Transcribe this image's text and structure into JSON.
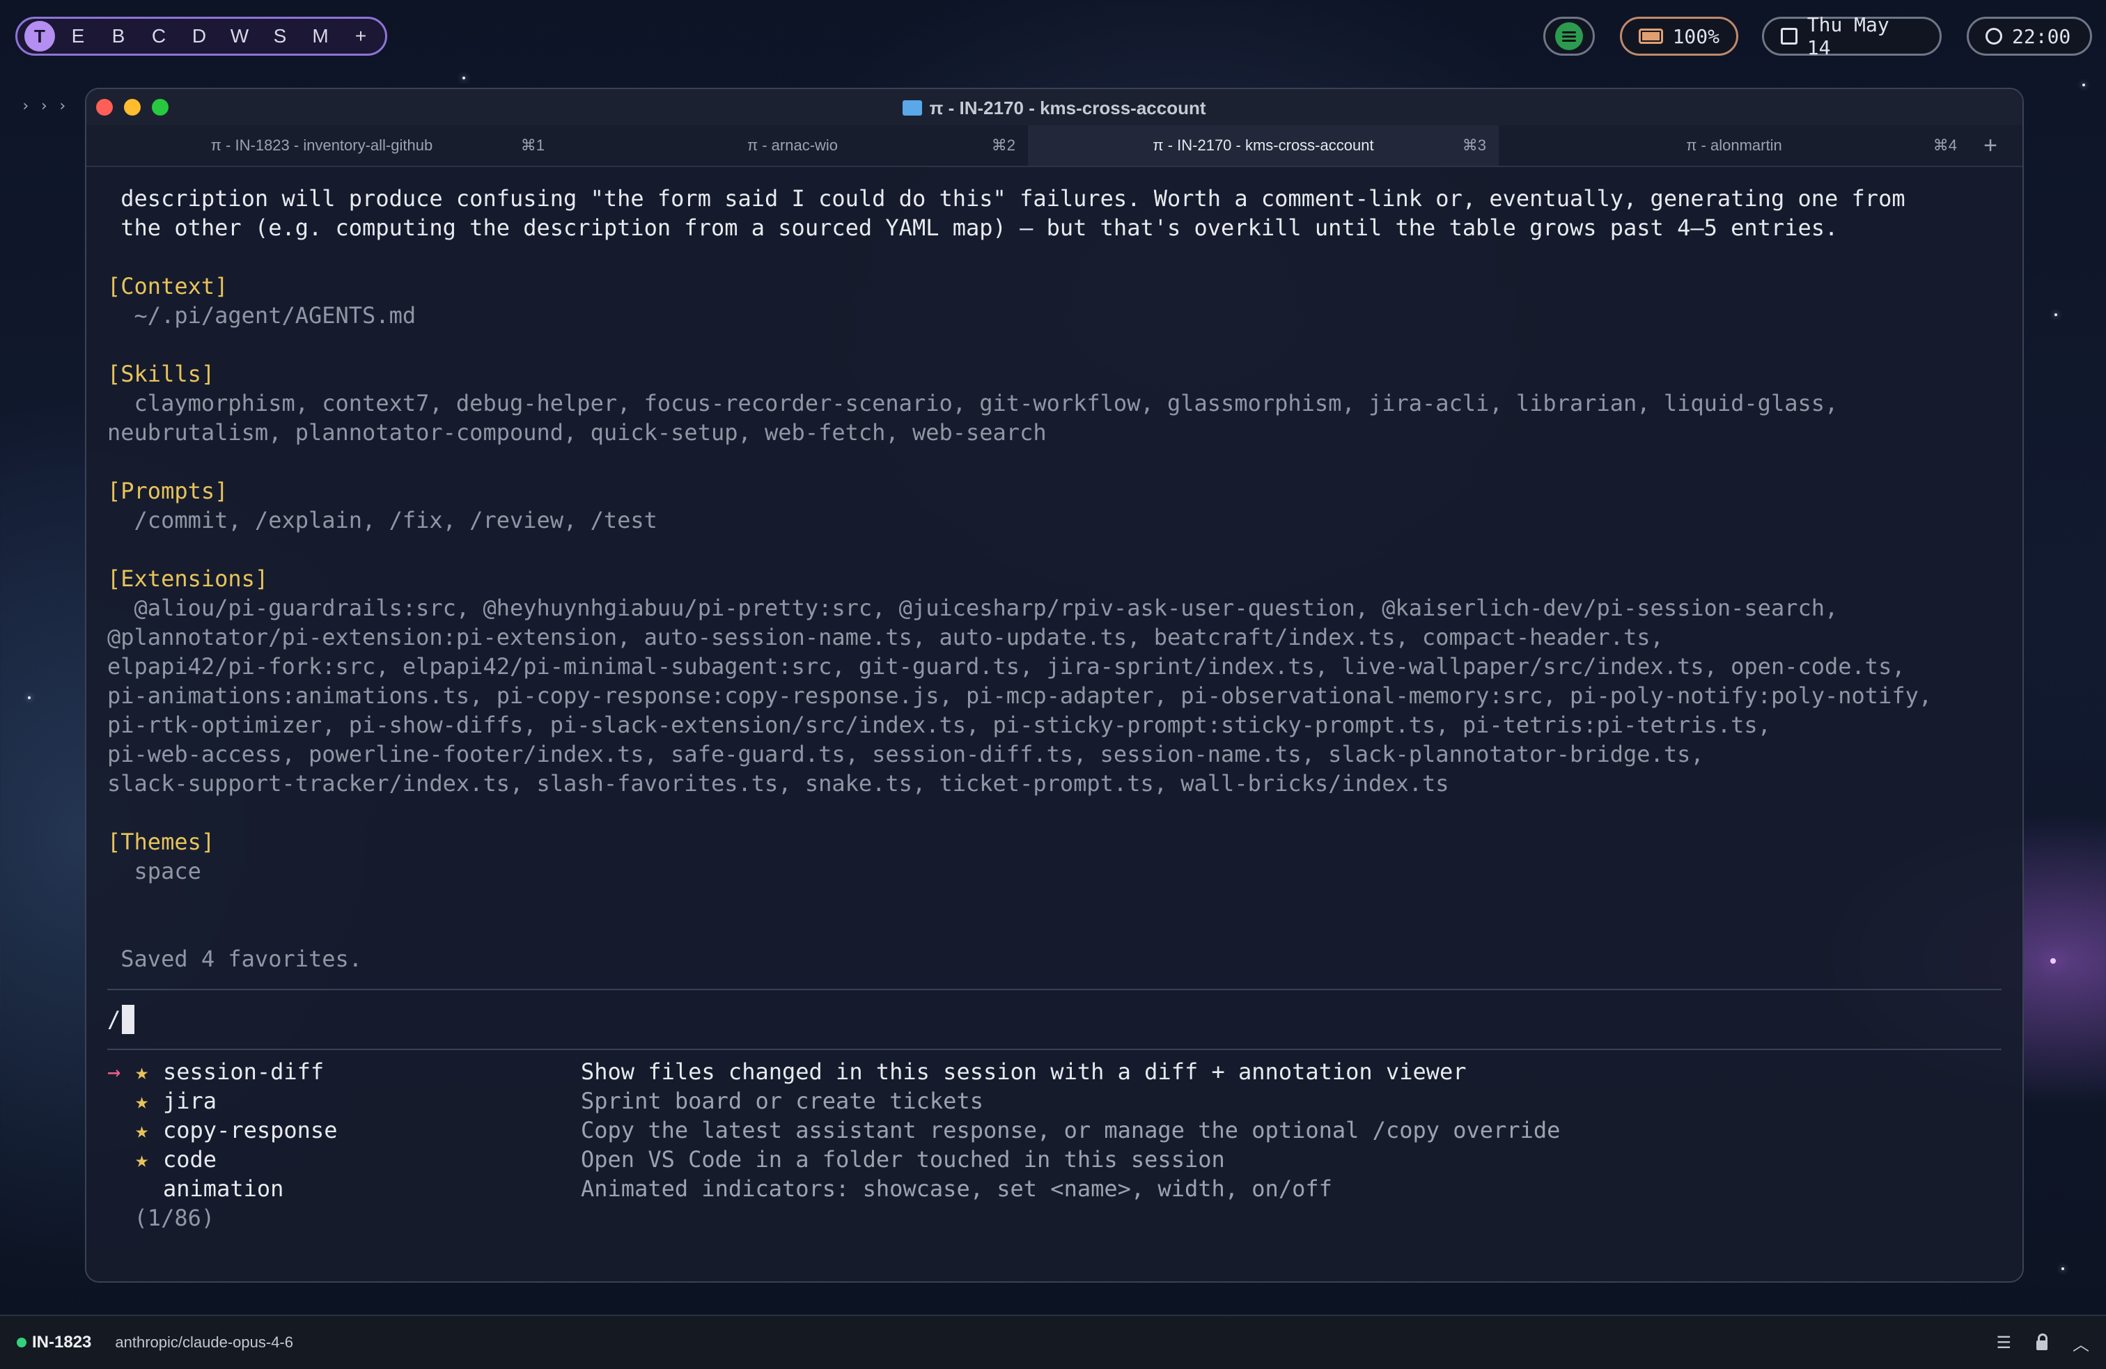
{
  "menubar": {
    "workspaces": [
      "T",
      "E",
      "B",
      "C",
      "D",
      "W",
      "S",
      "M",
      "+"
    ],
    "battery": "100%",
    "date": "Thu May 14",
    "time": "22:00"
  },
  "window": {
    "title": "π - IN-2170 - kms-cross-account",
    "tabs": [
      {
        "label": "π - IN-1823 - inventory-all-github",
        "shortcut": "⌘1"
      },
      {
        "label": "π - arnac-wio",
        "shortcut": "⌘2"
      },
      {
        "label": "π - IN-2170 - kms-cross-account",
        "shortcut": "⌘3"
      },
      {
        "label": "π - alonmartin",
        "shortcut": "⌘4"
      }
    ],
    "new_tab": "+"
  },
  "terminal": {
    "intro": [
      " description will produce confusing \"the form said I could do this\" failures. Worth a comment-link or, eventually, generating one from",
      " the other (e.g. computing the description from a sourced YAML map) — but that's overkill until the table grows past 4–5 entries."
    ],
    "context": {
      "header": "[Context]",
      "lines": [
        "  ~/.pi/agent/AGENTS.md"
      ]
    },
    "skills": {
      "header": "[Skills]",
      "lines": [
        "  claymorphism, context7, debug-helper, focus-recorder-scenario, git-workflow, glassmorphism, jira-acli, librarian, liquid-glass,",
        "neubrutalism, plannotator-compound, quick-setup, web-fetch, web-search"
      ]
    },
    "prompts": {
      "header": "[Prompts]",
      "lines": [
        "  /commit, /explain, /fix, /review, /test"
      ]
    },
    "extensions": {
      "header": "[Extensions]",
      "lines": [
        "  @aliou/pi-guardrails:src, @heyhuynhgiabuu/pi-pretty:src, @juicesharp/rpiv-ask-user-question, @kaiserlich-dev/pi-session-search,",
        "@plannotator/pi-extension:pi-extension, auto-session-name.ts, auto-update.ts, beatcraft/index.ts, compact-header.ts,",
        "elpapi42/pi-fork:src, elpapi42/pi-minimal-subagent:src, git-guard.ts, jira-sprint/index.ts, live-wallpaper/src/index.ts, open-code.ts,",
        "pi-animations:animations.ts, pi-copy-response:copy-response.js, pi-mcp-adapter, pi-observational-memory:src, pi-poly-notify:poly-notify,",
        "pi-rtk-optimizer, pi-show-diffs, pi-slack-extension/src/index.ts, pi-sticky-prompt:sticky-prompt.ts, pi-tetris:pi-tetris.ts,",
        "pi-web-access, powerline-footer/index.ts, safe-guard.ts, session-diff.ts, session-name.ts, slack-plannotator-bridge.ts,",
        "slack-support-tracker/index.ts, slash-favorites.ts, snake.ts, ticket-prompt.ts, wall-bricks/index.ts"
      ]
    },
    "themes": {
      "header": "[Themes]",
      "lines": [
        "  space"
      ]
    },
    "saved_message": " Saved 4 favorites.",
    "input_value": "/",
    "menu_arrow": "→",
    "star": "★",
    "commands": [
      {
        "name": "session-diff",
        "desc": "Show files changed in this session with a diff + annotation viewer",
        "favorite": true,
        "selected": true
      },
      {
        "name": "jira",
        "desc": "Sprint board or create tickets",
        "favorite": true,
        "selected": false
      },
      {
        "name": "copy-response",
        "desc": "Copy the latest assistant response, or manage the optional /copy override",
        "favorite": true,
        "selected": false
      },
      {
        "name": "code",
        "desc": "Open VS Code in a folder touched in this session",
        "favorite": true,
        "selected": false
      },
      {
        "name": "animation",
        "desc": "Animated indicators: showcase, set <name>, width, on/off",
        "favorite": false,
        "selected": false
      }
    ],
    "counter": "  (1/86)"
  },
  "statusbar": {
    "ticket": "IN-1823",
    "model": "anthropic/claude-opus-4-6"
  },
  "colors": {
    "accent": "#b48ef0",
    "section_header": "#e8c35a",
    "selection_arrow": "#f0608a",
    "status_ok": "#33d17a"
  }
}
